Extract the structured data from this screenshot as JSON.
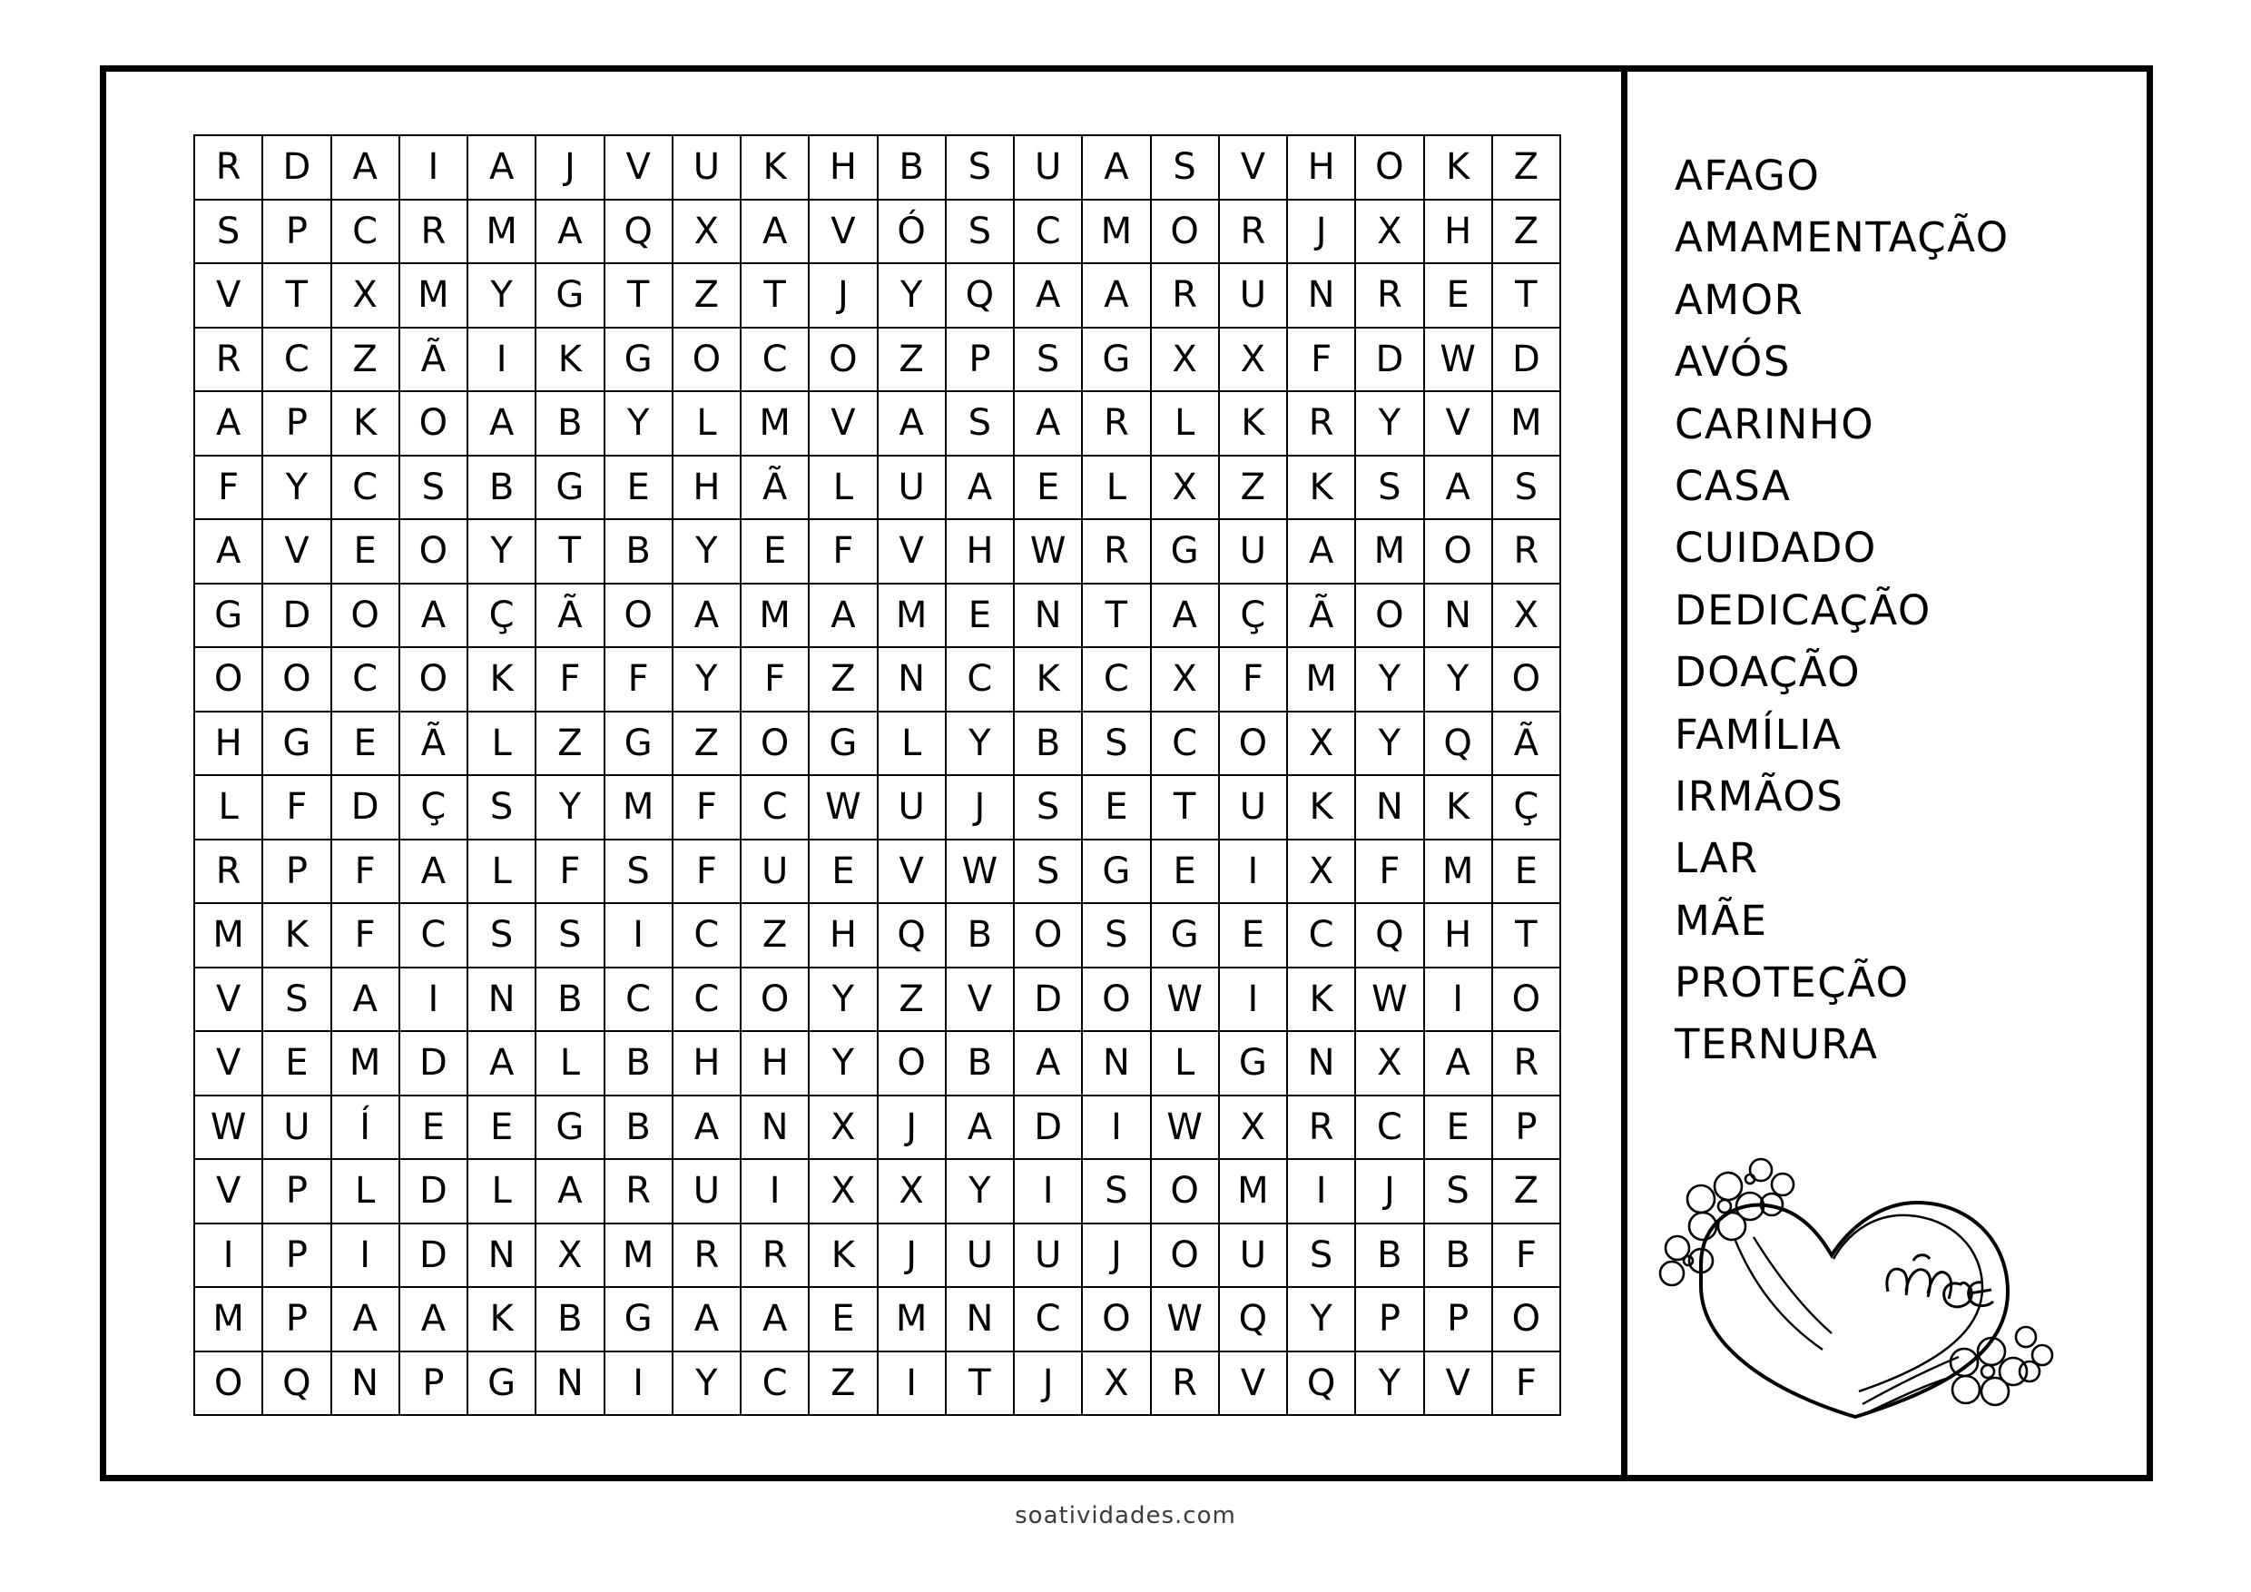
{
  "puzzle": {
    "grid_rows": 20,
    "grid_cols": 20,
    "grid": [
      [
        "R",
        "D",
        "A",
        "I",
        "A",
        "J",
        "V",
        "U",
        "K",
        "H",
        "B",
        "S",
        "U",
        "A",
        "S",
        "V",
        "H",
        "O",
        "K",
        "Z"
      ],
      [
        "S",
        "P",
        "C",
        "R",
        "M",
        "A",
        "Q",
        "X",
        "A",
        "V",
        "Ó",
        "S",
        "C",
        "M",
        "O",
        "R",
        "J",
        "X",
        "H",
        "Z"
      ],
      [
        "V",
        "T",
        "X",
        "M",
        "Y",
        "G",
        "T",
        "Z",
        "T",
        "J",
        "Y",
        "Q",
        "A",
        "A",
        "R",
        "U",
        "N",
        "R",
        "E",
        "T"
      ],
      [
        "R",
        "C",
        "Z",
        "Ã",
        "I",
        "K",
        "G",
        "O",
        "C",
        "O",
        "Z",
        "P",
        "S",
        "G",
        "X",
        "X",
        "F",
        "D",
        "W",
        "D"
      ],
      [
        "A",
        "P",
        "K",
        "O",
        "A",
        "B",
        "Y",
        "L",
        "M",
        "V",
        "A",
        "S",
        "A",
        "R",
        "L",
        "K",
        "R",
        "Y",
        "V",
        "M"
      ],
      [
        "F",
        "Y",
        "C",
        "S",
        "B",
        "G",
        "E",
        "H",
        "Ã",
        "L",
        "U",
        "A",
        "E",
        "L",
        "X",
        "Z",
        "K",
        "S",
        "A",
        "S"
      ],
      [
        "A",
        "V",
        "E",
        "O",
        "Y",
        "T",
        "B",
        "Y",
        "E",
        "F",
        "V",
        "H",
        "W",
        "R",
        "G",
        "U",
        "A",
        "M",
        "O",
        "R"
      ],
      [
        "G",
        "D",
        "O",
        "A",
        "Ç",
        "Ã",
        "O",
        "A",
        "M",
        "A",
        "M",
        "E",
        "N",
        "T",
        "A",
        "Ç",
        "Ã",
        "O",
        "N",
        "X"
      ],
      [
        "O",
        "O",
        "C",
        "O",
        "K",
        "F",
        "F",
        "Y",
        "F",
        "Z",
        "N",
        "C",
        "K",
        "C",
        "X",
        "F",
        "M",
        "Y",
        "Y",
        "O"
      ],
      [
        "H",
        "G",
        "E",
        "Ã",
        "L",
        "Z",
        "G",
        "Z",
        "O",
        "G",
        "L",
        "Y",
        "B",
        "S",
        "C",
        "O",
        "X",
        "Y",
        "Q",
        "Ã"
      ],
      [
        "L",
        "F",
        "D",
        "Ç",
        "S",
        "Y",
        "M",
        "F",
        "C",
        "W",
        "U",
        "J",
        "S",
        "E",
        "T",
        "U",
        "K",
        "N",
        "K",
        "Ç"
      ],
      [
        "R",
        "P",
        "F",
        "A",
        "L",
        "F",
        "S",
        "F",
        "U",
        "E",
        "V",
        "W",
        "S",
        "G",
        "E",
        "I",
        "X",
        "F",
        "M",
        "E"
      ],
      [
        "M",
        "K",
        "F",
        "C",
        "S",
        "S",
        "I",
        "C",
        "Z",
        "H",
        "Q",
        "B",
        "O",
        "S",
        "G",
        "E",
        "C",
        "Q",
        "H",
        "T"
      ],
      [
        "V",
        "S",
        "A",
        "I",
        "N",
        "B",
        "C",
        "C",
        "O",
        "Y",
        "Z",
        "V",
        "D",
        "O",
        "W",
        "I",
        "K",
        "W",
        "I",
        "O"
      ],
      [
        "V",
        "E",
        "M",
        "D",
        "A",
        "L",
        "B",
        "H",
        "H",
        "Y",
        "O",
        "B",
        "A",
        "N",
        "L",
        "G",
        "N",
        "X",
        "A",
        "R"
      ],
      [
        "W",
        "U",
        "Í",
        "E",
        "E",
        "G",
        "B",
        "A",
        "N",
        "X",
        "J",
        "A",
        "D",
        "I",
        "W",
        "X",
        "R",
        "C",
        "E",
        "P"
      ],
      [
        "V",
        "P",
        "L",
        "D",
        "L",
        "A",
        "R",
        "U",
        "I",
        "X",
        "X",
        "Y",
        "I",
        "S",
        "O",
        "M",
        "I",
        "J",
        "S",
        "Z"
      ],
      [
        "I",
        "P",
        "I",
        "D",
        "N",
        "X",
        "M",
        "R",
        "R",
        "K",
        "J",
        "U",
        "U",
        "J",
        "O",
        "U",
        "S",
        "B",
        "B",
        "F"
      ],
      [
        "M",
        "P",
        "A",
        "A",
        "K",
        "B",
        "G",
        "A",
        "A",
        "E",
        "M",
        "N",
        "C",
        "O",
        "W",
        "Q",
        "Y",
        "P",
        "P",
        "O"
      ],
      [
        "O",
        "Q",
        "N",
        "P",
        "G",
        "N",
        "I",
        "Y",
        "C",
        "Z",
        "I",
        "T",
        "J",
        "X",
        "R",
        "V",
        "Q",
        "Y",
        "V",
        "F"
      ]
    ]
  },
  "word_list": {
    "words": [
      "AFAGO",
      "AMAMENTAÇÃO",
      "AMOR",
      "AVÓS",
      "CARINHO",
      "CASA",
      "CUIDADO",
      "DEDICAÇÃO",
      "DOAÇÃO",
      "FAMÍLIA",
      "IRMÃOS",
      "LAR",
      "MÃE",
      "PROTEÇÃO",
      "TERNURA"
    ]
  },
  "decoration": {
    "heart_label": "mãe",
    "icon": "heart-with-flowers"
  },
  "footer": {
    "credit": "soatividades.com"
  },
  "colors": {
    "ink": "#000000",
    "page": "#ffffff",
    "credit": "#3b3b3b"
  }
}
